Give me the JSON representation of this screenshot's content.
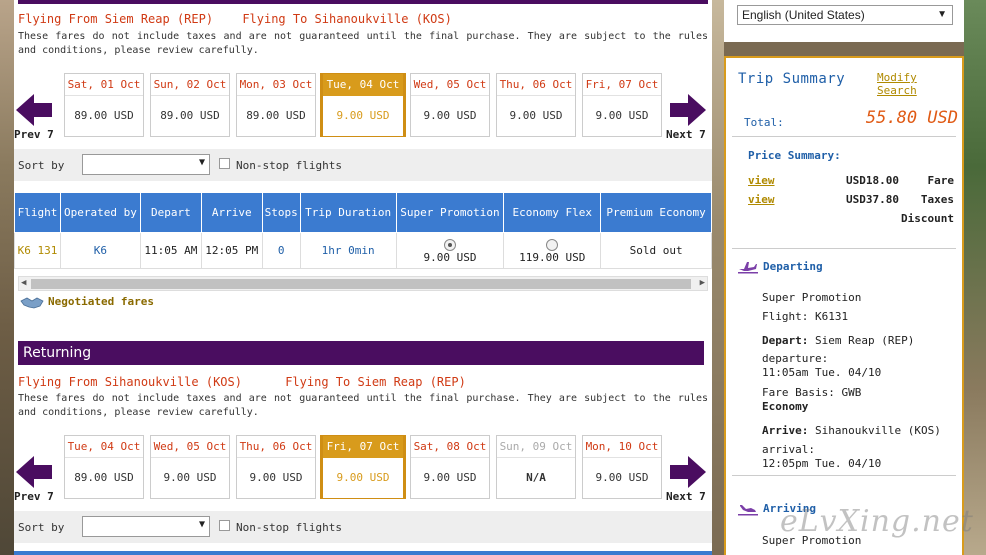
{
  "departing": {
    "route_from": "Flying From Siem Reap (REP)",
    "route_to": "Flying To Sihanoukville (KOS)",
    "notice": "These fares do not include taxes and are not guaranteed until the final purchase. They are subject to the rules and conditions, please review carefully.",
    "prev_label": "Prev 7",
    "next_label": "Next 7",
    "days": [
      {
        "date": "Sat, 01 Oct",
        "price": "89.00 USD"
      },
      {
        "date": "Sun, 02 Oct",
        "price": "89.00 USD"
      },
      {
        "date": "Mon, 03 Oct",
        "price": "89.00 USD"
      },
      {
        "date": "Tue, 04 Oct",
        "price": "9.00 USD"
      },
      {
        "date": "Wed, 05 Oct",
        "price": "9.00 USD"
      },
      {
        "date": "Thu, 06 Oct",
        "price": "9.00 USD"
      },
      {
        "date": "Fri, 07 Oct",
        "price": "9.00 USD"
      }
    ],
    "sort_label": "Sort by",
    "nonstop_label": "Non-stop flights",
    "table": {
      "headers": [
        "Flight",
        "Operated by",
        "Depart",
        "Arrive",
        "Stops",
        "Trip Duration",
        "Super Promotion",
        "Economy Flex",
        "Premium Economy"
      ],
      "row": {
        "flight": "K6 131",
        "operated_by": "K6",
        "depart": "11:05 AM",
        "arrive": "12:05 PM",
        "stops": "0",
        "duration": "1hr 0min",
        "super_promotion": "9.00 USD",
        "economy_flex": "119.00 USD",
        "premium_economy": "Sold out"
      }
    },
    "negotiated": "Negotiated fares"
  },
  "returning": {
    "section_title": "Returning",
    "route_from": "Flying From Sihanoukville (KOS)",
    "route_to": "Flying To Siem Reap (REP)",
    "notice": "These fares do not include taxes and are not guaranteed until the final purchase. They are subject to the rules and conditions, please review carefully.",
    "prev_label": "Prev 7",
    "next_label": "Next 7",
    "days": [
      {
        "date": "Tue, 04 Oct",
        "price": "89.00 USD"
      },
      {
        "date": "Wed, 05 Oct",
        "price": "9.00 USD"
      },
      {
        "date": "Thu, 06 Oct",
        "price": "9.00 USD"
      },
      {
        "date": "Fri, 07 Oct",
        "price": "9.00 USD"
      },
      {
        "date": "Sat, 08 Oct",
        "price": "9.00 USD"
      },
      {
        "date": "Sun, 09 Oct",
        "price": "N/A"
      },
      {
        "date": "Mon, 10 Oct",
        "price": "9.00 USD"
      }
    ],
    "sort_label": "Sort by",
    "nonstop_label": "Non-stop flights"
  },
  "language": {
    "selected": "English (United States)"
  },
  "summary": {
    "title": "Trip Summary",
    "modify": "Modify Search",
    "total_label": "Total:",
    "total_value": "55.80 USD",
    "price_title": "Price Summary:",
    "rows": [
      {
        "view": "view",
        "amount": "USD18.00",
        "kind": "Fare"
      },
      {
        "view": "view",
        "amount": "USD37.80",
        "kind": "Taxes"
      },
      {
        "view": "",
        "amount": "",
        "kind": "Discount"
      }
    ],
    "departing": {
      "title": "Departing",
      "fare_type": "Super Promotion",
      "flight": "Flight: K6131",
      "depart_label": "Depart:",
      "depart_place": "Siem Reap (REP)",
      "departure_label": "departure:",
      "departure_time": "11:05am Tue. 04/10",
      "fare_basis": "Fare Basis: GWB",
      "cabin": "Economy",
      "arrive_label": "Arrive:",
      "arrive_place": "Sihanoukville (KOS)",
      "arrival_label": "arrival:",
      "arrival_time": "12:05pm Tue. 04/10"
    },
    "arriving": {
      "title": "Arriving",
      "fare_type": "Super Promotion"
    }
  },
  "watermark": "eLvXing.net",
  "colors": {
    "accent_purple": "#4a0d60",
    "selected_gold": "#d89b1c",
    "table_blue": "#3b7bd0",
    "route_red": "#d03a14"
  }
}
